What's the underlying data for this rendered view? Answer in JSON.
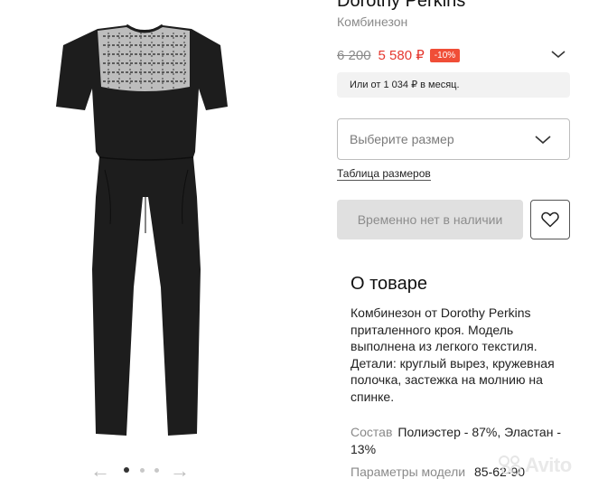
{
  "product": {
    "brand": "Dorothy Perkins",
    "category": "Комбинезон",
    "old_price": "6 200",
    "new_price": "5 580 ₽",
    "discount": "-10%",
    "installment": "Или от 1 034 ₽ в месяц."
  },
  "size": {
    "placeholder": "Выберите размер",
    "table_link": "Таблица размеров"
  },
  "actions": {
    "unavailable_label": "Временно нет в наличии"
  },
  "about": {
    "title": "О товаре",
    "description": "Комбинезон от Dorothy Perkins приталенного кроя. Модель выполнена из легкого текстиля. Детали: круглый вырез, кружевная полочка, застежка на молнию на спинке."
  },
  "specs": {
    "composition_key": "Состав",
    "composition_val": "Полиэстер - 87%, Эластан - 13%",
    "params_key": "Параметры модели",
    "params_val": "85-62-90"
  },
  "gallery": {
    "total_dots": 4,
    "active_dot": 1
  },
  "watermark": "Avito",
  "colors": {
    "sale_red": "#e5382f",
    "badge_red": "#f04e37",
    "garment": "#1c1c1c"
  },
  "icons": [
    "chevron-down-icon",
    "heart-icon",
    "arrow-left-icon",
    "arrow-right-icon",
    "avito-logo-icon"
  ]
}
